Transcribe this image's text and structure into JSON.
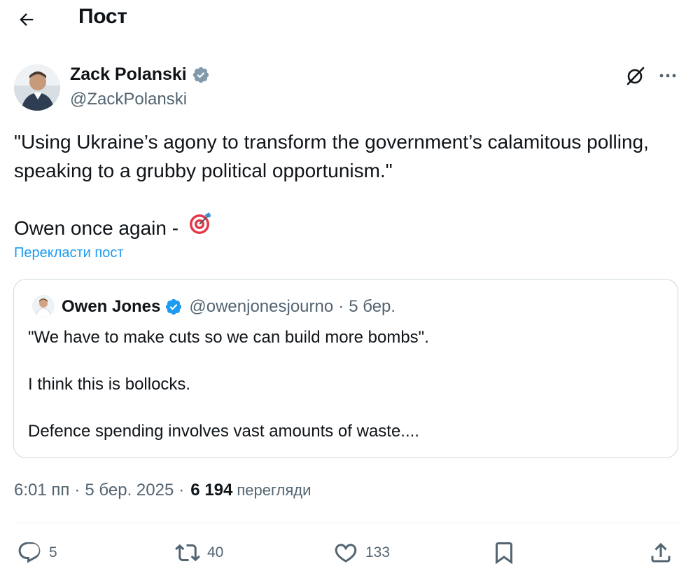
{
  "header": {
    "title": "Пост",
    "back_icon": "arrow-left-icon"
  },
  "post": {
    "author_name": "Zack Polanski",
    "author_handle": "@ZackPolanski",
    "text_line1": "\"Using Ukraine’s agony to transform the government’s calamitous polling, speaking to a grubby political opportunism.\"",
    "text_line2": "Owen once again - ",
    "translate_label": "Перекласти пост",
    "time": "6:01 пп",
    "date": "5 бер. 2025",
    "views_count": "6 194",
    "views_label": "перегляди"
  },
  "quote": {
    "author_name": "Owen Jones",
    "author_handle": "@owenjonesjourno",
    "separator": "·",
    "date": "5 бер.",
    "lines": [
      "\"We have to make cuts so we can build more bombs\".",
      "I think this is bollocks.",
      "Defence spending involves vast amounts of waste...."
    ]
  },
  "actions": {
    "replies": "5",
    "reposts": "40",
    "likes": "133"
  },
  "colors": {
    "accent": "#1d9bf0",
    "text": "#0f1419",
    "secondary": "#536471",
    "verified": "#1d9bf0",
    "border": "#cfd9de"
  },
  "icons": [
    "arrow-left-icon",
    "verified-badge-icon",
    "grok-icon",
    "more-icon",
    "target-emoji-icon",
    "reply-icon",
    "repost-icon",
    "like-icon",
    "bookmark-icon",
    "share-icon"
  ]
}
